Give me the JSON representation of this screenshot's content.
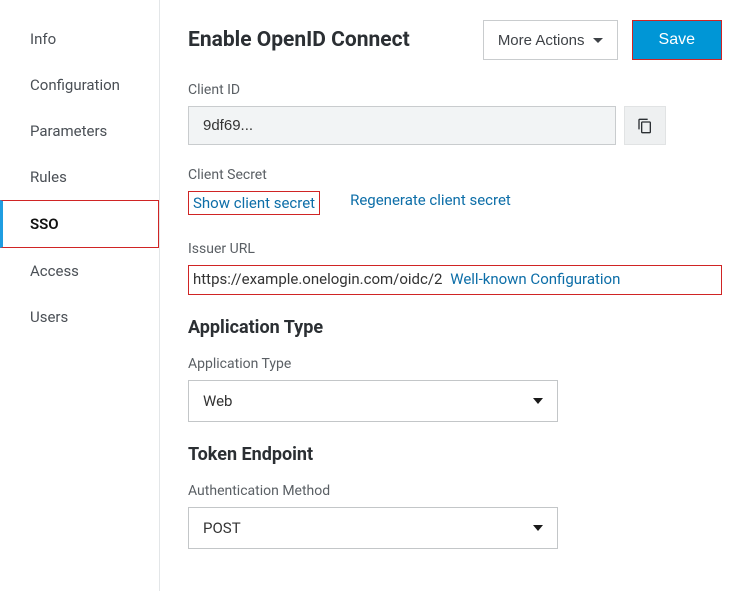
{
  "sidebar": {
    "items": [
      {
        "label": "Info",
        "active": false
      },
      {
        "label": "Configuration",
        "active": false
      },
      {
        "label": "Parameters",
        "active": false
      },
      {
        "label": "Rules",
        "active": false
      },
      {
        "label": "SSO",
        "active": true
      },
      {
        "label": "Access",
        "active": false
      },
      {
        "label": "Users",
        "active": false
      }
    ]
  },
  "header": {
    "title": "Enable OpenID Connect",
    "more_actions_label": "More Actions",
    "save_label": "Save"
  },
  "client_id": {
    "label": "Client ID",
    "value": "9df69..."
  },
  "client_secret": {
    "label": "Client Secret",
    "show_label": "Show client secret",
    "regenerate_label": "Regenerate client secret"
  },
  "issuer": {
    "label": "Issuer URL",
    "value": "https://example.onelogin.com/oidc/2",
    "wellknown_label": "Well-known Configuration"
  },
  "application_type": {
    "section_title": "Application Type",
    "label": "Application Type",
    "value": "Web"
  },
  "token_endpoint": {
    "section_title": "Token Endpoint",
    "label": "Authentication Method",
    "value": "POST"
  }
}
